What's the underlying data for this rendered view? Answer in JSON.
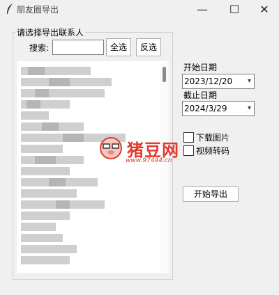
{
  "window": {
    "title": "朋友圈导出",
    "minimize": "—",
    "maximize": "☐",
    "close": "✕"
  },
  "contacts": {
    "group_label": "请选择导出联系人",
    "search_label": "搜索:",
    "search_value": "",
    "select_all_label": "全选",
    "reverse_select_label": "反选"
  },
  "dates": {
    "start_label": "开始日期",
    "start_value": "2023/12/20",
    "end_label": "截止日期",
    "end_value": "2024/3/29"
  },
  "options": {
    "download_images_label": "下载图片",
    "download_images_checked": false,
    "transcode_video_label": "视频转码",
    "transcode_video_checked": false
  },
  "export_button_label": "开始导出",
  "watermark": {
    "text": "猪豆网",
    "url": "www.97444.cn"
  }
}
